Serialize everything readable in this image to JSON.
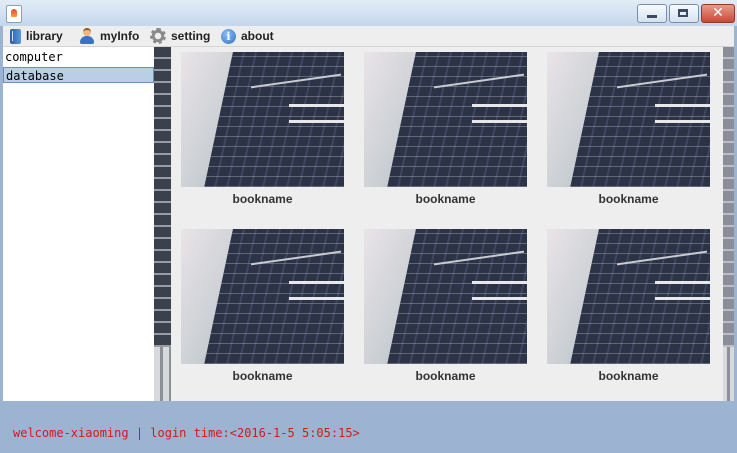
{
  "window": {
    "title": ""
  },
  "menu": [
    {
      "label": "library",
      "icon": "book-icon"
    },
    {
      "label": "myInfo",
      "icon": "user-icon"
    },
    {
      "label": "setting",
      "icon": "gear-icon"
    },
    {
      "label": "about",
      "icon": "info-icon"
    }
  ],
  "sidebar": {
    "items": [
      {
        "label": "computer",
        "selected": false
      },
      {
        "label": "database",
        "selected": true
      }
    ]
  },
  "books": [
    {
      "name": "bookname"
    },
    {
      "name": "bookname"
    },
    {
      "name": "bookname"
    },
    {
      "name": "bookname"
    },
    {
      "name": "bookname"
    },
    {
      "name": "bookname"
    }
  ],
  "status": {
    "text": "welcome-xiaoming | login time:<2016-1-5 5:05:15>"
  },
  "colors": {
    "status_text": "#d11a1a",
    "selection": "#b8cfe5",
    "frame": "#9cb4d1"
  }
}
